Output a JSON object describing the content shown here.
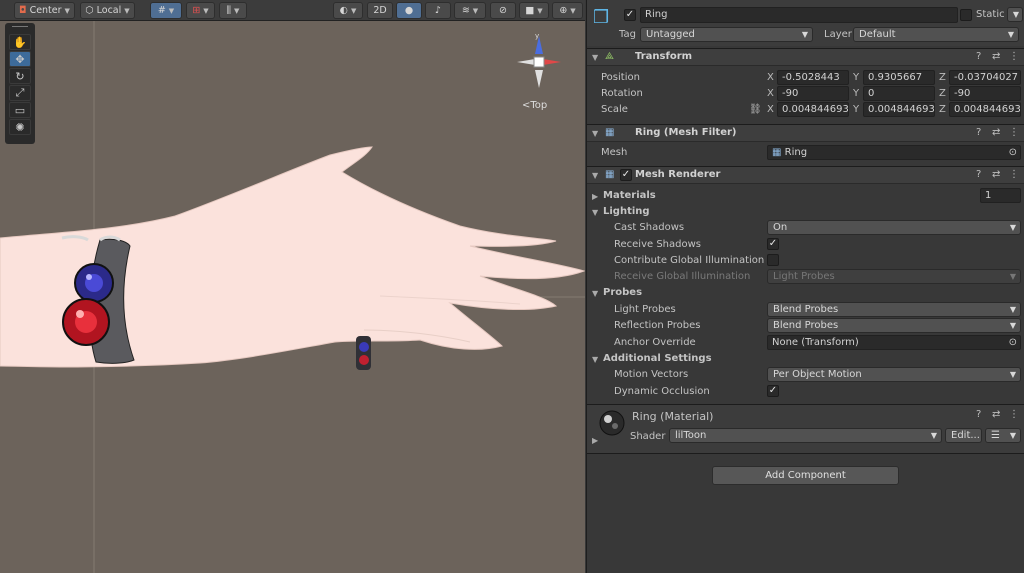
{
  "toolbar": {
    "pivot": "Center",
    "space": "Local",
    "mode_2d": "2D"
  },
  "scene": {
    "view_label": "Top"
  },
  "object": {
    "name": "Ring",
    "static_label": "Static",
    "static_checked": "✓",
    "tag_label": "Tag",
    "tag_value": "Untagged",
    "layer_label": "Layer",
    "layer_value": "Default"
  },
  "transform": {
    "title": "Transform",
    "position_label": "Position",
    "rotation_label": "Rotation",
    "scale_label": "Scale",
    "axes": {
      "x": "X",
      "y": "Y",
      "z": "Z"
    },
    "position": {
      "x": "-0.5028443",
      "y": "0.9305667",
      "z": "-0.03704027"
    },
    "rotation": {
      "x": "-90",
      "y": "0",
      "z": "-90"
    },
    "scale": {
      "x": "0.004844693",
      "y": "0.004844693",
      "z": "0.004844693"
    }
  },
  "mesh_filter": {
    "title": "Ring (Mesh Filter)",
    "mesh_label": "Mesh",
    "mesh_value": "Ring"
  },
  "mesh_renderer": {
    "title": "Mesh Renderer",
    "enabled": "✓",
    "materials_label": "Materials",
    "materials_count": "1",
    "lighting_label": "Lighting",
    "cast_shadows_label": "Cast Shadows",
    "cast_shadows_value": "On",
    "receive_shadows_label": "Receive Shadows",
    "receive_shadows": "✓",
    "contribute_gi_label": "Contribute Global Illumination",
    "contribute_gi": "",
    "receive_gi_label": "Receive Global Illumination",
    "receive_gi_value": "Light Probes",
    "probes_label": "Probes",
    "light_probes_label": "Light Probes",
    "light_probes_value": "Blend Probes",
    "reflection_probes_label": "Reflection Probes",
    "reflection_probes_value": "Blend Probes",
    "anchor_override_label": "Anchor Override",
    "anchor_override_value": "None (Transform)",
    "additional_label": "Additional Settings",
    "motion_vectors_label": "Motion Vectors",
    "motion_vectors_value": "Per Object Motion",
    "dynamic_occlusion_label": "Dynamic Occlusion",
    "dynamic_occlusion": "✓"
  },
  "material": {
    "title": "Ring (Material)",
    "shader_label": "Shader",
    "shader_value": "lilToon",
    "edit_label": "Edit..."
  },
  "add_component": "Add Component",
  "colors": {
    "scene_bg": "#6c635b",
    "inspector_bg": "#383838",
    "accent": "#4f6e93",
    "skin": "#fbe2dc"
  }
}
